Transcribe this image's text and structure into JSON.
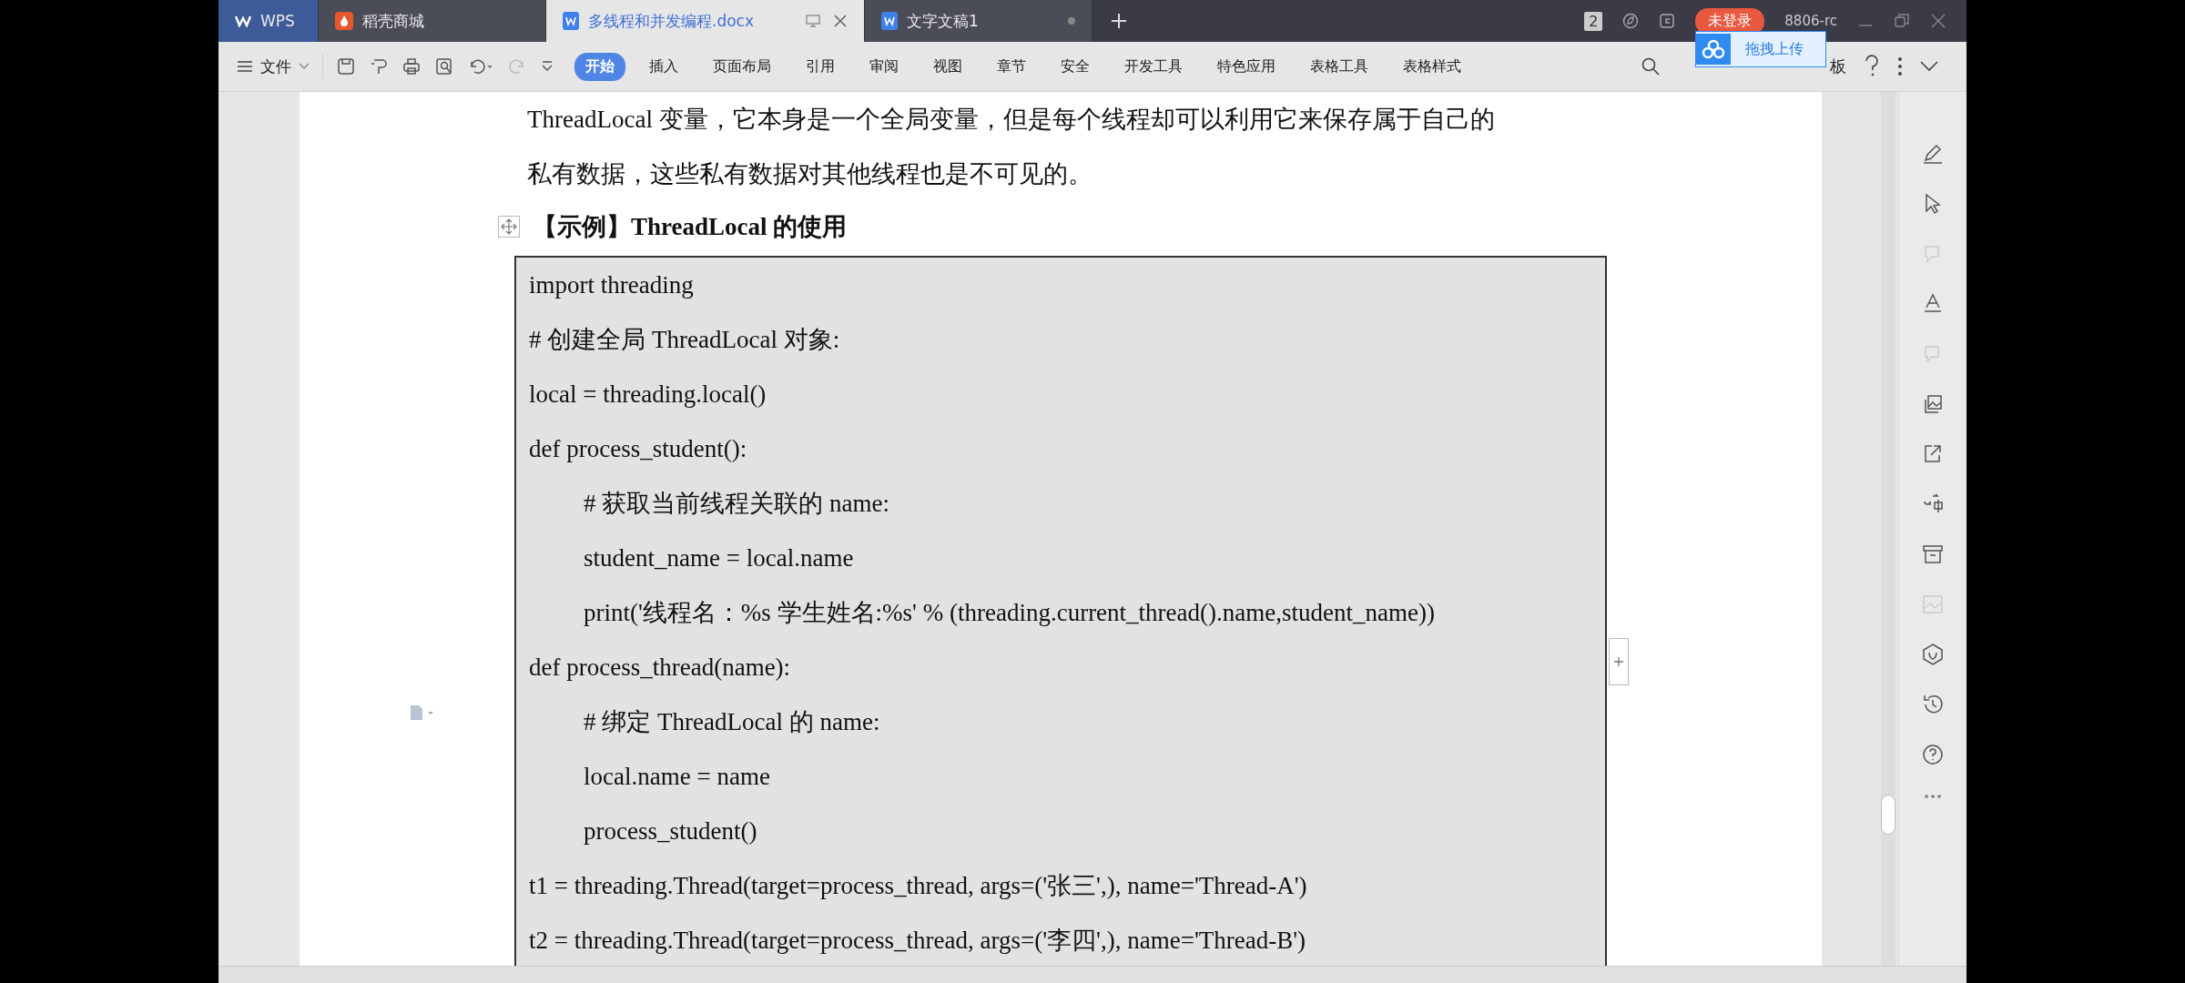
{
  "tabs": [
    {
      "label": "WPS",
      "kind": "home",
      "selected": false
    },
    {
      "label": "稻壳商城",
      "kind": "store",
      "selected": false
    },
    {
      "label": "多线程和并发编程.docx",
      "kind": "doc",
      "selected": true
    },
    {
      "label": "文字文稿1",
      "kind": "doc",
      "selected": false
    }
  ],
  "title_bar": {
    "window_count": "2",
    "login_button": "未登录",
    "user": "8806-rc"
  },
  "file_menu": "文件",
  "ribbon_tabs": [
    {
      "label": "开始",
      "selected": true
    },
    {
      "label": "插入",
      "selected": false
    },
    {
      "label": "页面布局",
      "selected": false
    },
    {
      "label": "引用",
      "selected": false
    },
    {
      "label": "审阅",
      "selected": false
    },
    {
      "label": "视图",
      "selected": false
    },
    {
      "label": "章节",
      "selected": false
    },
    {
      "label": "安全",
      "selected": false
    },
    {
      "label": "开发工具",
      "selected": false
    },
    {
      "label": "特色应用",
      "selected": false
    },
    {
      "label": "表格工具",
      "selected": false
    },
    {
      "label": "表格样式",
      "selected": false
    }
  ],
  "upload_popup": "拖拽上传",
  "partial_label": "板",
  "document": {
    "paragraph": [
      "ThreadLocal  变量，它本身是一个全局变量，但是每个线程却可以利用它来保存属于自己的",
      "私有数据，这些私有数据对其他线程也是不可见的。"
    ],
    "heading": "【示例】ThreadLocal 的使用",
    "code": [
      {
        "text": "import threading"
      },
      {
        "text": "#  创建全局 ThreadLocal 对象:"
      },
      {
        "text": "local = threading.local()"
      },
      {
        "text": "def process_student():",
        "children": [
          {
            "text": "#  获取当前线程关联的 name:"
          },
          {
            "text": "student_name = local.name"
          },
          {
            "text": "print('线程名：%s  学生姓名:%s' % (threading.current_thread().name,student_name))"
          }
        ]
      },
      {
        "text": "def process_thread(name):",
        "children": [
          {
            "text": "#  绑定 ThreadLocal 的 name:"
          },
          {
            "text": "local.name = name"
          },
          {
            "text": "process_student()"
          }
        ]
      },
      {
        "text": "t1 = threading.Thread(target=process_thread, args=('张三',), name='Thread-A')"
      },
      {
        "text": "t2 = threading.Thread(target=process_thread, args=('李四',), name='Thread-B')"
      }
    ]
  }
}
